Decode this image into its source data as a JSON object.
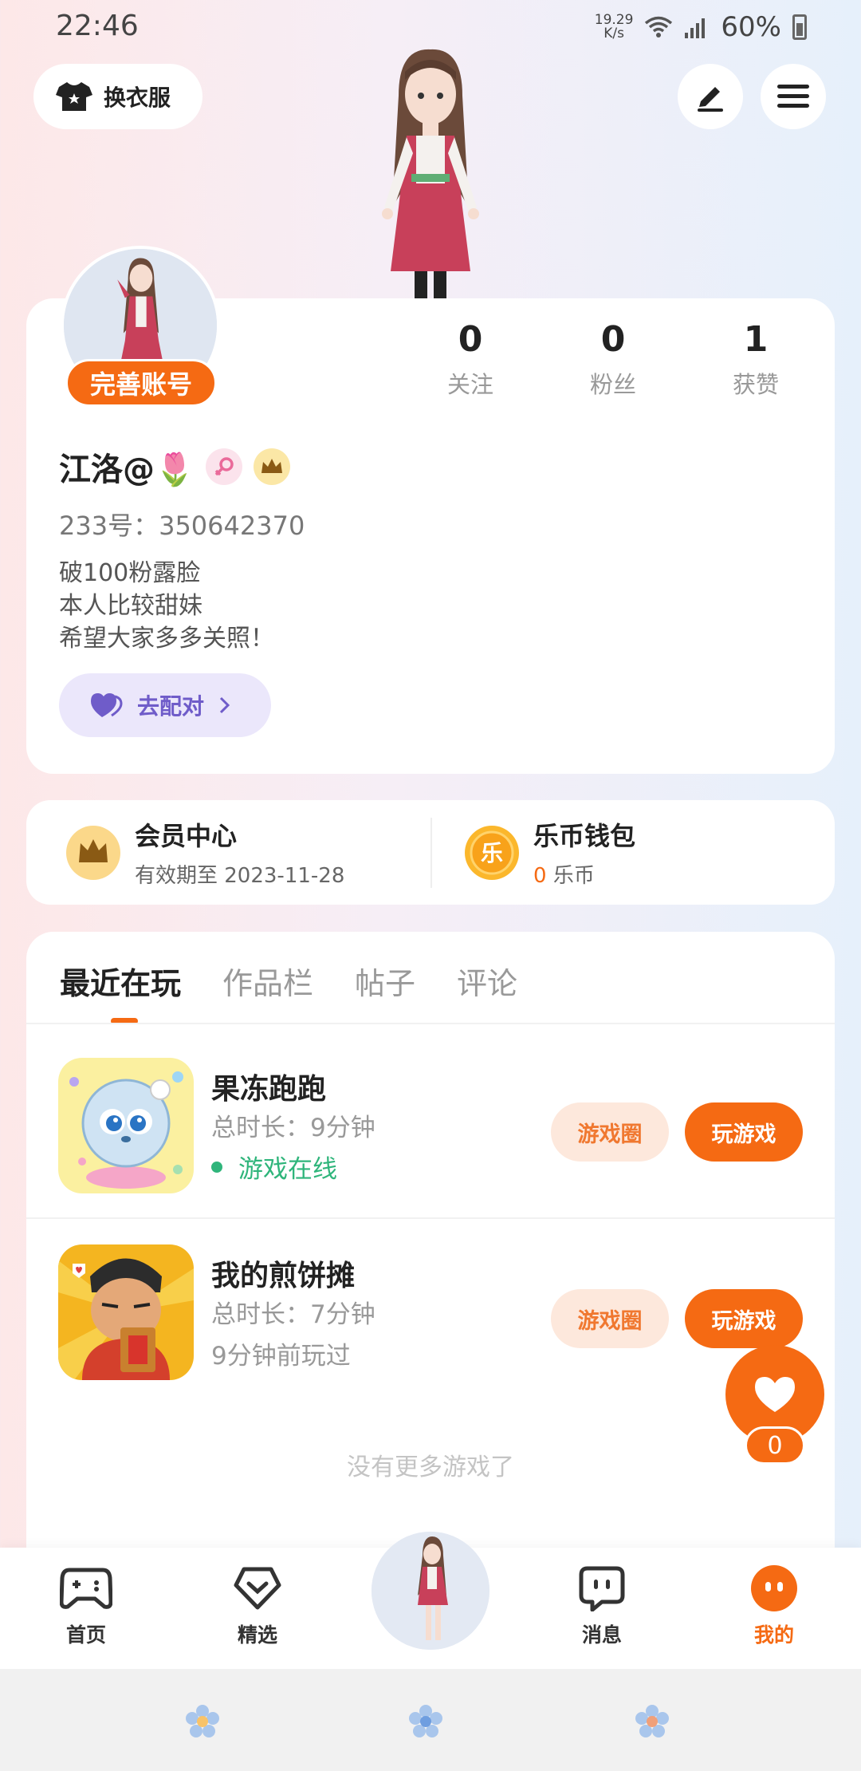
{
  "status_bar": {
    "time": "22:46",
    "net_speed_value": "19.29",
    "net_speed_unit": "K/s",
    "battery": "60%"
  },
  "header": {
    "outfit_label": "换衣服",
    "edit_icon": "pen-icon",
    "menu_icon": "hamburger-icon"
  },
  "profile": {
    "complete_account": "完善账号",
    "stats": [
      {
        "value": "0",
        "label": "关注"
      },
      {
        "value": "0",
        "label": "粉丝"
      },
      {
        "value": "1",
        "label": "获赞"
      }
    ],
    "username": "江洛@🌷",
    "uid": "233号：350642370",
    "bio_lines": [
      "破100粉露脸",
      "本人比较甜妹",
      "希望大家多多关照！"
    ],
    "match_button": "去配对"
  },
  "vip": {
    "member_title": "会员中心",
    "member_sub": "有效期至 2023-11-28",
    "wallet_title": "乐币钱包",
    "coin_amount": "0",
    "coin_unit": "乐币",
    "coin_glyph": "乐"
  },
  "tabs": [
    "最近在玩",
    "作品栏",
    "帖子",
    "评论"
  ],
  "games": [
    {
      "name": "果冻跑跑",
      "time": "总时长：9分钟",
      "status": "游戏在线",
      "circle_btn": "游戏圈",
      "play_btn": "玩游戏"
    },
    {
      "name": "我的煎饼摊",
      "time": "总时长：7分钟",
      "status": "9分钟前玩过",
      "circle_btn": "游戏圈",
      "play_btn": "玩游戏"
    }
  ],
  "no_more": "没有更多游戏了",
  "like_count": "0",
  "nav": [
    {
      "label": "首页",
      "icon": "gamepad-icon"
    },
    {
      "label": "精选",
      "icon": "heart-shield-icon"
    },
    {
      "label": "消息",
      "icon": "chat-icon"
    },
    {
      "label": "我的",
      "icon": "profile-face-icon"
    }
  ],
  "colors": {
    "accent": "#f56a13",
    "online": "#2fb57b",
    "match": "#6f5cc9"
  }
}
